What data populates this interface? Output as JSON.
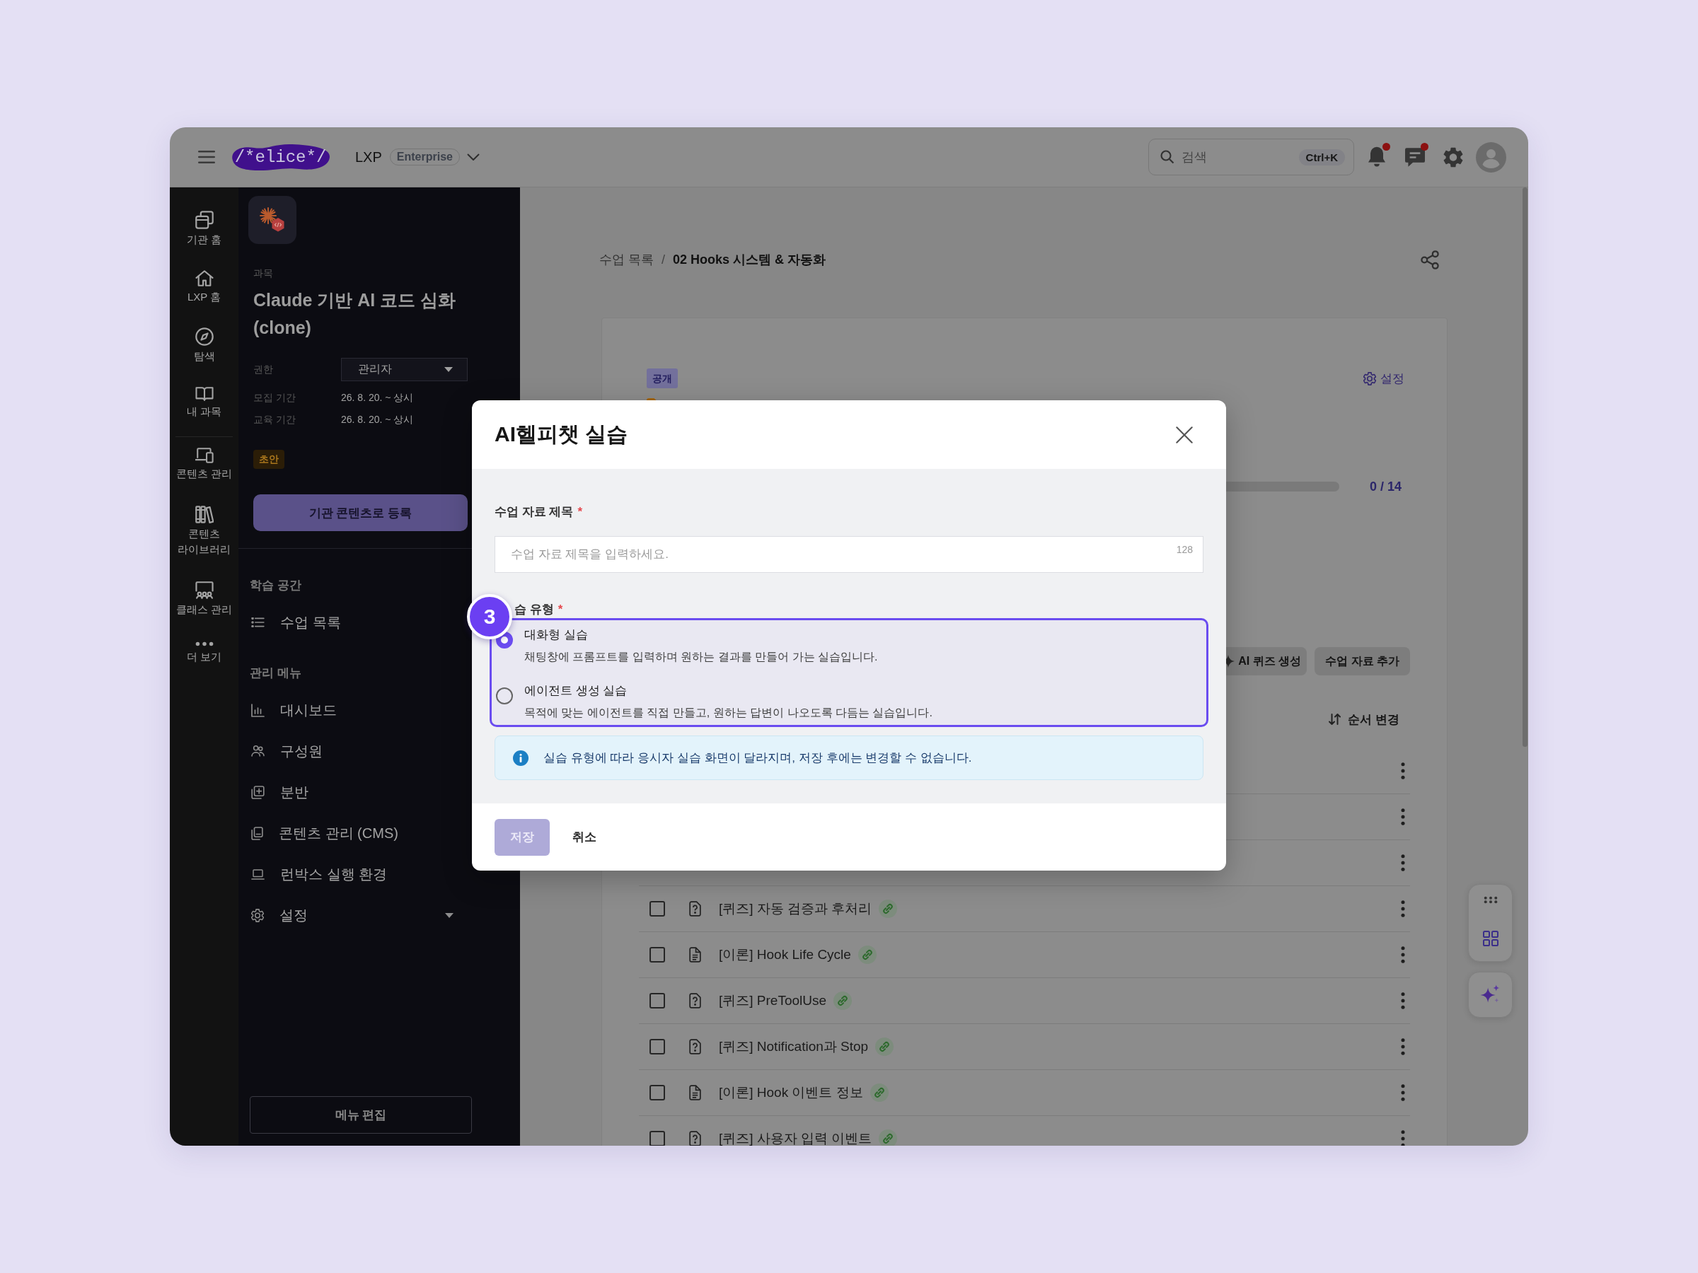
{
  "topbar": {
    "logo": "/*elice*/",
    "product": "LXP",
    "edition": "Enterprise",
    "search": {
      "placeholder": "검색",
      "shortcut": "Ctrl+K"
    },
    "notifications": {
      "unread": true
    },
    "messages": {
      "unread": true
    }
  },
  "rail": {
    "groups": [
      {
        "items": [
          {
            "label": "기관 홈"
          },
          {
            "label": "LXP 홈"
          },
          {
            "label": "탐색"
          },
          {
            "label": "내 과목"
          }
        ]
      },
      {
        "items": [
          {
            "label": "콘텐츠 관리"
          },
          {
            "label": "콘텐츠 라이브러리"
          },
          {
            "label": "클래스 관리"
          },
          {
            "label": "더 보기"
          }
        ]
      }
    ]
  },
  "sidebar": {
    "course": {
      "category": "과목",
      "title": "Claude 기반 AI 코드 심화 (clone)",
      "details": [
        {
          "kind": "select",
          "label": "권한",
          "value": "관리자"
        },
        {
          "kind": "text",
          "label": "모집 기간",
          "value": "26. 8. 20. ~ 상시"
        },
        {
          "kind": "text",
          "label": "교육 기간",
          "value": "26. 8. 20. ~ 상시"
        }
      ],
      "status": "초안",
      "register_button": "기관 콘텐츠로 등록"
    },
    "sections": [
      {
        "title": "학습 공간",
        "items": [
          {
            "label": "수업 목록",
            "has_submenu": false
          }
        ]
      },
      {
        "title": "관리 메뉴",
        "items": [
          {
            "label": "대시보드",
            "has_submenu": false
          },
          {
            "label": "구성원",
            "has_submenu": false
          },
          {
            "label": "분반",
            "has_submenu": false
          },
          {
            "label": "콘텐츠 관리 (CMS)",
            "has_submenu": false
          },
          {
            "label": "런박스 실행 환경",
            "has_submenu": false
          },
          {
            "label": "설정",
            "has_submenu": true
          }
        ]
      }
    ],
    "menu_edit_button": "메뉴 편집"
  },
  "main": {
    "breadcrumb": {
      "items": [
        "수업 목록",
        "02 Hooks 시스템 & 자동화"
      ],
      "separator": "/"
    },
    "card": {
      "visibility": "공개",
      "settings_link": "설정",
      "progress": {
        "reading": "0 / 14"
      },
      "actions": [
        {
          "kind": "ai",
          "label": "AI 퀴즈 생성"
        },
        {
          "kind": "plain",
          "label": "수업 자료 추가"
        }
      ],
      "reorder_button": "순서 변경",
      "rows": [
        {
          "kind": "covered"
        },
        {
          "kind": "covered"
        },
        {
          "kind": "covered"
        },
        {
          "kind": "quiz",
          "title": "[퀴즈] 자동 검증과 후처리",
          "checked": false,
          "linked": true
        },
        {
          "kind": "theory",
          "title": "[이론] Hook Life Cycle",
          "checked": false,
          "linked": true
        },
        {
          "kind": "quiz",
          "title": "[퀴즈] PreToolUse",
          "checked": false,
          "linked": true
        },
        {
          "kind": "quiz",
          "title": "[퀴즈] Notification과 Stop",
          "checked": false,
          "linked": true
        },
        {
          "kind": "theory",
          "title": "[이론] Hook 이벤트 정보",
          "checked": false,
          "linked": true
        },
        {
          "kind": "quiz",
          "title": "[퀴즈] 사용자 입력 이벤트",
          "checked": false,
          "linked": true
        }
      ]
    }
  },
  "dialog": {
    "title": "AI헬피챗 실습",
    "tutorial_step": "3",
    "title_field": {
      "label": "수업 자료 제목",
      "required_mark": "*",
      "placeholder": "수업 자료 제목을 입력하세요.",
      "limit": "128"
    },
    "type_field": {
      "label": "습 유형",
      "required_mark": "*",
      "highlighted": true,
      "options": [
        {
          "title": "대화형 실습",
          "description": "채팅창에 프롬프트를 입력하며 원하는 결과를 만들어 가는 실습입니다.",
          "selected": true
        },
        {
          "title": "에이전트 생성 실습",
          "description": "목적에 맞는 에이전트를 직접 만들고, 원하는 답변이 나오도록 다듬는 실습입니다.",
          "selected": false
        }
      ]
    },
    "notice": "실습 유형에 따라 응시자 실습 화면이 달라지며, 저장 후에는 변경할 수 없습니다.",
    "buttons": [
      {
        "kind": "primary",
        "label": "저장",
        "disabled": true
      },
      {
        "kind": "text",
        "label": "취소",
        "disabled": false
      }
    ]
  }
}
